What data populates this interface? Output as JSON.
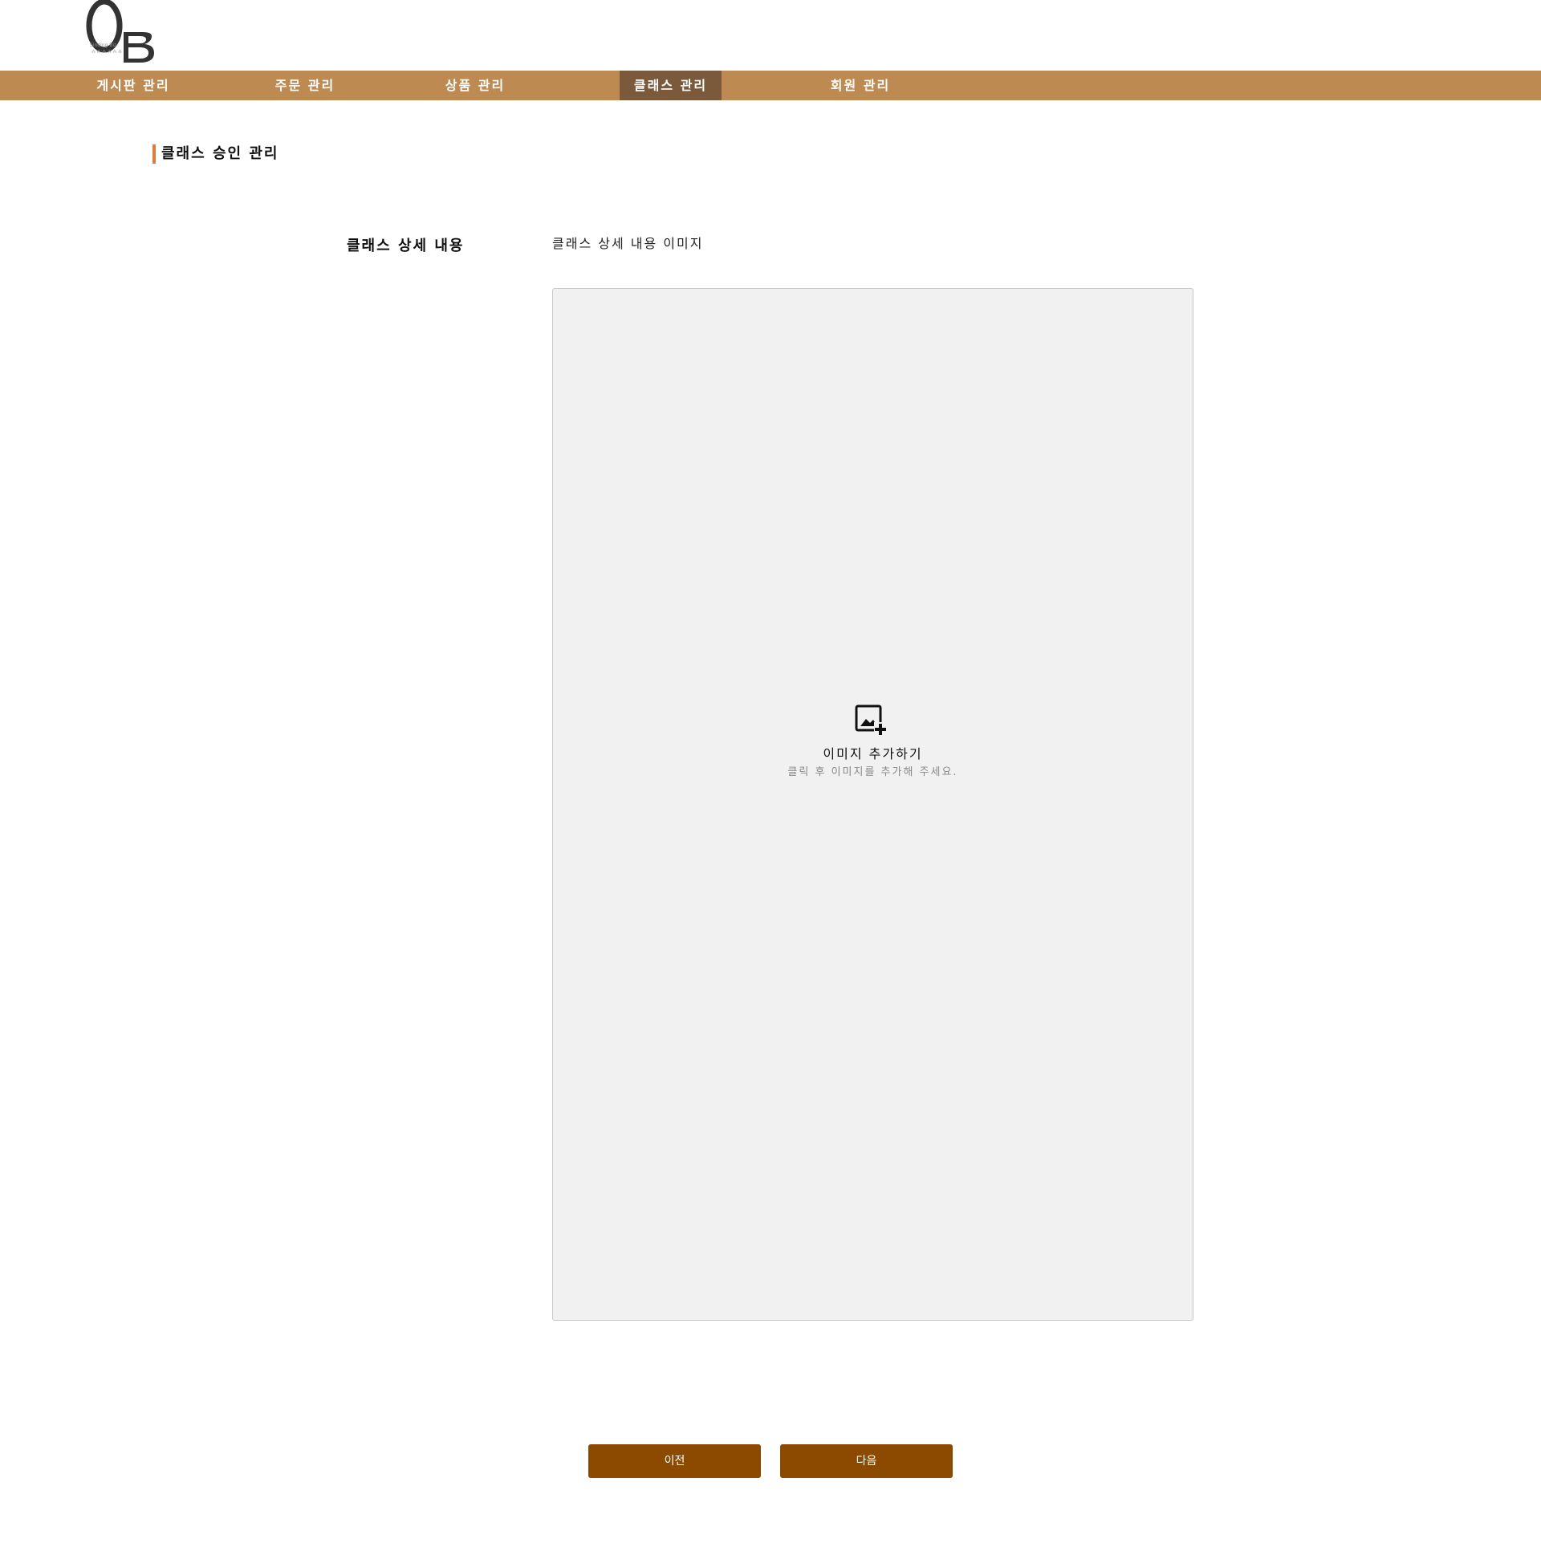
{
  "brand": {
    "logo_text": "OB",
    "logo_icon": "ob-logo-icon"
  },
  "nav": {
    "items": [
      {
        "label": "게시판 관리"
      },
      {
        "label": "주문 관리"
      },
      {
        "label": "상품 관리"
      },
      {
        "label": "클래스 관리",
        "active": true
      },
      {
        "label": "회원 관리"
      }
    ]
  },
  "page": {
    "title": "클래스 승인 관리"
  },
  "form": {
    "section_label": "클래스 상세 내용",
    "image_field_label": "클래스 상세 내용 이미지",
    "dropzone": {
      "icon": "add-image-icon",
      "title": "이미지 추가하기",
      "subtitle": "클릭 후 이미지를 추가해 주세요."
    }
  },
  "actions": {
    "prev_label": "이전",
    "next_label": "다음"
  },
  "colors": {
    "nav_bg": "#bd8a52",
    "nav_active_bg": "#7a5a3a",
    "title_accent": "#e07b39",
    "button_bg": "#8b4a00",
    "dropzone_bg": "#f1f1f1"
  }
}
